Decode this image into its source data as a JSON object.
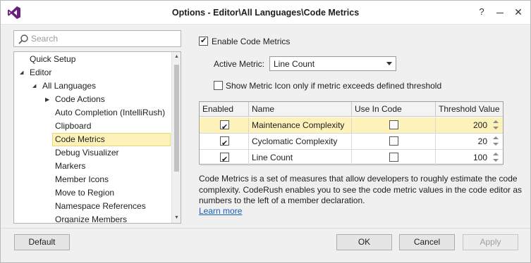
{
  "window": {
    "title": "Options - Editor\\All Languages\\Code Metrics",
    "help_label": "?",
    "close_label": "✕"
  },
  "search": {
    "placeholder": "Search"
  },
  "tree": {
    "items": [
      {
        "label": "Quick Setup",
        "level": 0,
        "expander": ""
      },
      {
        "label": "Editor",
        "level": 0,
        "expander": "expanded"
      },
      {
        "label": "All Languages",
        "level": 1,
        "expander": "expanded"
      },
      {
        "label": "Code Actions",
        "level": 2,
        "expander": "collapsed"
      },
      {
        "label": "Auto Completion (IntelliRush)",
        "level": 2,
        "expander": ""
      },
      {
        "label": "Clipboard",
        "level": 2,
        "expander": ""
      },
      {
        "label": "Code Metrics",
        "level": 2,
        "expander": "",
        "selected": true
      },
      {
        "label": "Debug Visualizer",
        "level": 2,
        "expander": ""
      },
      {
        "label": "Markers",
        "level": 2,
        "expander": ""
      },
      {
        "label": "Member Icons",
        "level": 2,
        "expander": ""
      },
      {
        "label": "Move to Region",
        "level": 2,
        "expander": ""
      },
      {
        "label": "Namespace References",
        "level": 2,
        "expander": ""
      },
      {
        "label": "Organize Members",
        "level": 2,
        "expander": ""
      }
    ]
  },
  "settings": {
    "enable_label": "Enable Code Metrics",
    "enable_checked": true,
    "active_metric_label": "Active Metric:",
    "active_metric_value": "Line Count",
    "show_icon_label": "Show Metric Icon only if metric exceeds defined threshold",
    "show_icon_checked": false
  },
  "grid": {
    "columns": [
      "Enabled",
      "Name",
      "Use In Code Analysis",
      "Threshold Value"
    ],
    "rows": [
      {
        "enabled": true,
        "name": "Maintenance Complexity",
        "use_in_analysis": false,
        "threshold": "200",
        "selected": true
      },
      {
        "enabled": true,
        "name": "Cyclomatic Complexity",
        "use_in_analysis": false,
        "threshold": "20",
        "selected": false
      },
      {
        "enabled": true,
        "name": "Line Count",
        "use_in_analysis": false,
        "threshold": "100",
        "selected": false
      }
    ]
  },
  "description": {
    "text": "Code Metrics is a set of measures that allow developers to roughly estimate the code complexity. CodeRush enables you to see the code metric values in the code editor as numbers to the left of a member declaration.",
    "link": "Learn more"
  },
  "buttons": {
    "default": "Default",
    "ok": "OK",
    "cancel": "Cancel",
    "apply": "Apply"
  },
  "colors": {
    "accent": "#68217a",
    "selection": "#fdf2b9",
    "link": "#1a5fb4"
  }
}
